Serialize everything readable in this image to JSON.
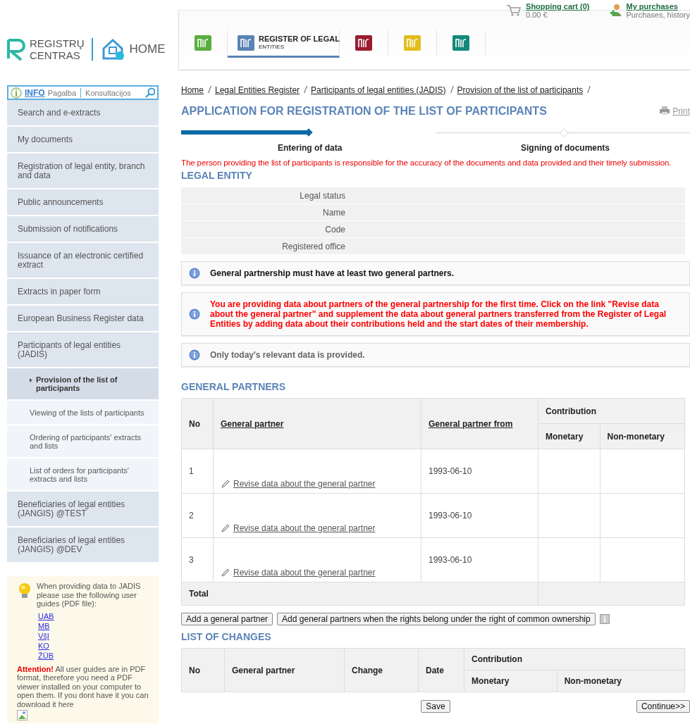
{
  "logo": {
    "lines": [
      "REGISTRŲ",
      "CENTRAS"
    ],
    "home": "HOME"
  },
  "topnav": {
    "tabs": [
      {
        "color": "#5aae3f",
        "selected": false
      },
      {
        "color": "#5b82b5",
        "selected": true,
        "label": "REGISTER OF LEGAL",
        "sublabel": "ENTITIES"
      },
      {
        "color": "#9b1b30",
        "selected": false
      },
      {
        "color": "#e3bd1c",
        "selected": false
      },
      {
        "color": "#14897a",
        "selected": false
      }
    ],
    "cart": {
      "label": "Shopping cart (0)",
      "amount": "0.00 €"
    },
    "purchases": {
      "label": "My purchases",
      "sub": "Purchases, history"
    }
  },
  "infobar": {
    "info": "INFO",
    "links": [
      "Pagalba",
      "Konsultacijos"
    ]
  },
  "sidebar": {
    "items": [
      {
        "label": "Search and e-extracts",
        "selected": false
      },
      {
        "label": "My documents",
        "selected": false
      },
      {
        "label": "Registration of legal entity, branch and data",
        "selected": false
      },
      {
        "label": "Public announcements",
        "selected": false
      },
      {
        "label": "Submission of notifications",
        "selected": false
      },
      {
        "label": "Issuance of an electronic certified extract",
        "selected": false
      },
      {
        "label": "Extracts in paper form",
        "selected": false
      },
      {
        "label": "European Business Register data",
        "selected": false
      },
      {
        "label": "Participants of legal entities (JADIS)",
        "selected": false,
        "children": [
          {
            "label": "Provision of the list of participants",
            "selected": true
          },
          {
            "label": "Viewing of the lists of participants",
            "selected": false
          },
          {
            "label": "Ordering of participants' extracts and lists",
            "selected": false
          },
          {
            "label": "List of orders for participants' extracts and lists",
            "selected": false
          }
        ]
      },
      {
        "label": "Beneficiaries of legal entities (JANGIS) @TEST",
        "selected": false
      },
      {
        "label": "Beneficiaries of legal entities (JANGIS) @DEV",
        "selected": false
      }
    ]
  },
  "tip": {
    "text": "When providing data to JADIS please use the following user guides (PDF file):",
    "links": [
      "UAB",
      "MB",
      "VšĮ",
      "KO",
      "ŽŪB"
    ],
    "attention": "**Attention!** All user guides are in PDF format, therefore you need a PDF viewer installed on your computer to open them. If you dont have it you can download it here"
  },
  "breadcrumb": [
    "Home",
    "Legal Entities Register",
    "Participants of legal entities (JADIS)",
    "Provision of the list of participants"
  ],
  "title": "APPLICATION FOR REGISTRATION OF THE LIST OF PARTICIPANTS",
  "print": "Print",
  "steps": [
    {
      "label": "Entering of data",
      "selected": true
    },
    {
      "label": "Signing of documents",
      "selected": false
    }
  ],
  "responsibility": "The person providing the list of participants is responsible for the accuracy of the documents and data provided and their timely submission.",
  "legal_entity": {
    "heading": "LEGAL ENTITY",
    "fields": [
      "Legal status",
      "Name",
      "Code",
      "Registered office"
    ]
  },
  "notices": [
    {
      "kind": "info",
      "text": "General partnership must have at least two general partners."
    },
    {
      "kind": "warning",
      "text": "You are providing data about partners of the general partnership for the first time. Click on the link \"Revise data about the general partner\" and supplement the data about general partners transferred from the Register of Legal Entities by adding data about their contributions held and the start dates of their membership."
    },
    {
      "kind": "muted",
      "text": "Only today's relevant data is provided."
    }
  ],
  "general_partners": {
    "heading": "GENERAL PARTNERS",
    "columns": [
      "No",
      "General partner",
      "General partner from",
      "Contribution",
      "Monetary",
      "Non-monetary"
    ],
    "rows": [
      {
        "no": "1",
        "link": "Revise data about the general partner",
        "from": "1993-06-10"
      },
      {
        "no": "2",
        "link": "Revise data about the general partner",
        "from": "1993-06-10"
      },
      {
        "no": "3",
        "link": "Revise data about the general partner",
        "from": "1993-06-10"
      }
    ],
    "total": "Total"
  },
  "buttons": [
    "Add a general partner",
    "Add general partners when the rights belong under the right of common ownership"
  ],
  "changes": {
    "heading": "LIST OF CHANGES",
    "columns": [
      "No",
      "General partner",
      "Change",
      "Date",
      "Contribution",
      "Monetary",
      "Non-monetary"
    ]
  },
  "save": "Save",
  "continue": "Continue>>"
}
